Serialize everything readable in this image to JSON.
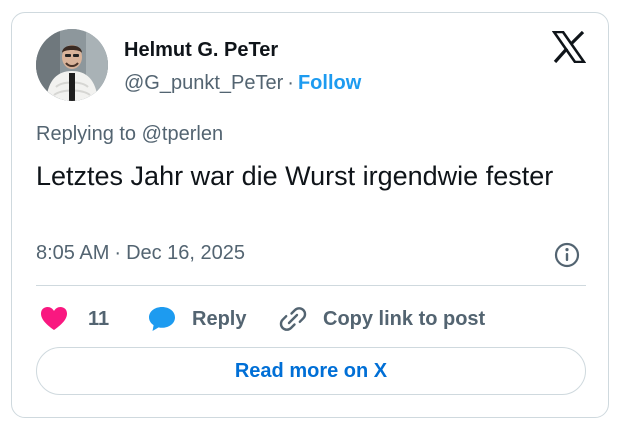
{
  "author": {
    "display_name": "Helmut G. PeTer",
    "handle": "@G_punkt_PeTer",
    "separator": "·",
    "follow_label": "Follow"
  },
  "replying": {
    "prefix": "Replying to ",
    "mention": "@tperlen"
  },
  "post": {
    "text": "Letztes Jahr war die Wurst irgendwie fester",
    "time": "8:05 AM",
    "separator": "·",
    "date": "Dec 16, 2025"
  },
  "actions": {
    "like_count": "11",
    "reply_label": "Reply",
    "copy_label": "Copy link to post"
  },
  "read_more_label": "Read more on X",
  "icons": {
    "brand": "x-logo-icon",
    "info": "info-icon",
    "like": "heart-icon",
    "reply": "speech-bubble-icon",
    "copy": "link-icon"
  },
  "colors": {
    "like": "#f91880",
    "reply": "#1d9bf0",
    "follow": "#1d9bf0",
    "read_more": "#006fd6",
    "muted": "#536471",
    "border": "#cfd9de"
  }
}
